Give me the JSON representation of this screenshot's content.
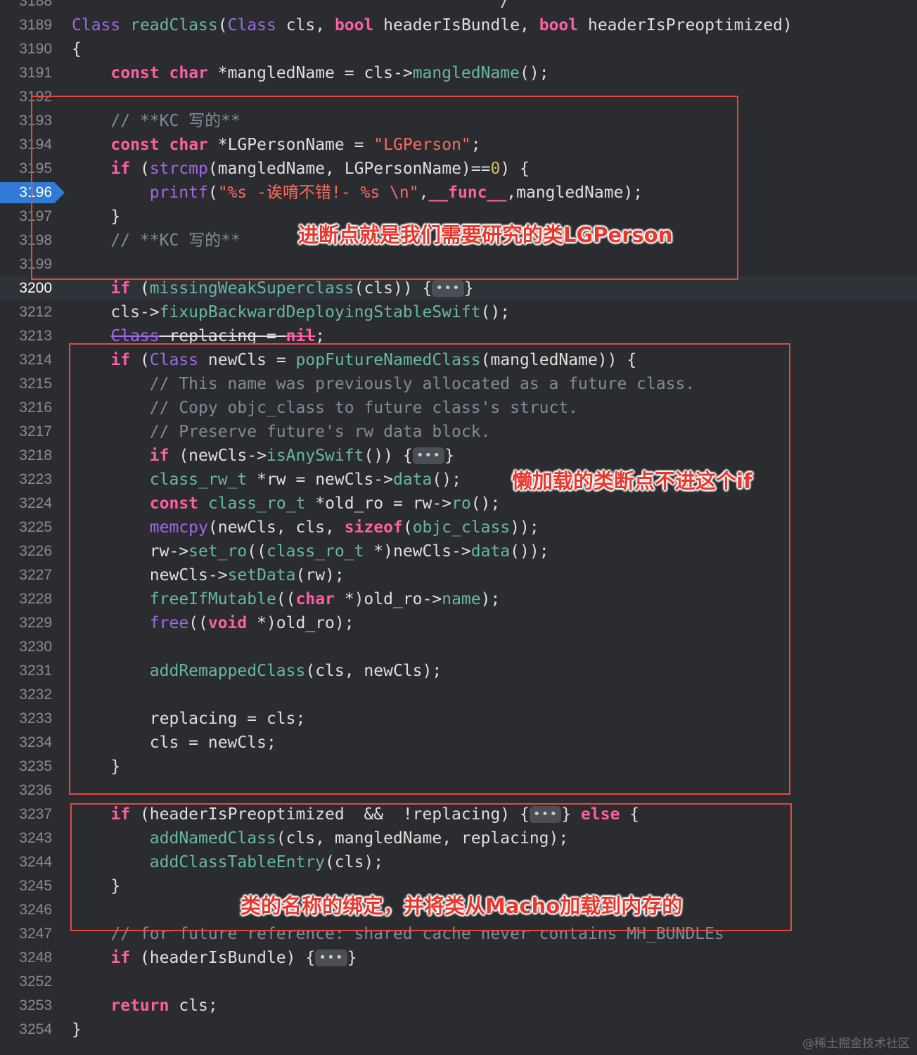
{
  "editor": {
    "lines": [
      {
        "n": "3188",
        "segs": [
          [
            "pl",
            "                                            /"
          ]
        ]
      },
      {
        "n": "3189",
        "segs": [
          [
            "m",
            "Class"
          ],
          [
            "pl",
            " "
          ],
          [
            "f",
            "readClass"
          ],
          [
            "pl",
            "("
          ],
          [
            "m",
            "Class"
          ],
          [
            "pl",
            " cls, "
          ],
          [
            "k",
            "bool"
          ],
          [
            "pl",
            " headerIsBundle, "
          ],
          [
            "k",
            "bool"
          ],
          [
            "pl",
            " headerIsPreoptimized)"
          ]
        ]
      },
      {
        "n": "3190",
        "segs": [
          [
            "pl",
            "{"
          ]
        ]
      },
      {
        "n": "3191",
        "segs": [
          [
            "pl",
            "    "
          ],
          [
            "k",
            "const"
          ],
          [
            "pl",
            " "
          ],
          [
            "k",
            "char"
          ],
          [
            "pl",
            " *mangledName = cls->"
          ],
          [
            "f",
            "mangledName"
          ],
          [
            "pl",
            "();"
          ]
        ]
      },
      {
        "n": "3192",
        "segs": []
      },
      {
        "n": "3193",
        "segs": [
          [
            "pl",
            "    "
          ],
          [
            "c",
            "// **KC 写的**"
          ]
        ]
      },
      {
        "n": "3194",
        "segs": [
          [
            "pl",
            "    "
          ],
          [
            "k",
            "const"
          ],
          [
            "pl",
            " "
          ],
          [
            "k",
            "char"
          ],
          [
            "pl",
            " *LGPersonName = "
          ],
          [
            "s",
            "\"LGPerson\""
          ],
          [
            "pl",
            ";"
          ]
        ]
      },
      {
        "n": "3195",
        "segs": [
          [
            "pl",
            "    "
          ],
          [
            "k",
            "if"
          ],
          [
            "pl",
            " ("
          ],
          [
            "m",
            "strcmp"
          ],
          [
            "pl",
            "(mangledName, LGPersonName)=="
          ],
          [
            "n",
            "0"
          ],
          [
            "pl",
            ") {"
          ]
        ]
      },
      {
        "n": "3196",
        "mark": "breakpoint",
        "segs": [
          [
            "pl",
            "        "
          ],
          [
            "m",
            "printf"
          ],
          [
            "pl",
            "("
          ],
          [
            "s",
            "\"%s -诶唷不错!- %s \\n\""
          ],
          [
            "pl",
            ","
          ],
          [
            "k",
            "__func__"
          ],
          [
            "pl",
            ",mangledName);"
          ]
        ]
      },
      {
        "n": "3197",
        "segs": [
          [
            "pl",
            "    }"
          ]
        ]
      },
      {
        "n": "3198",
        "segs": [
          [
            "pl",
            "    "
          ],
          [
            "c",
            "// **KC 写的**"
          ]
        ]
      },
      {
        "n": "3199",
        "segs": []
      },
      {
        "n": "3200",
        "mark": "current",
        "segs": [
          [
            "pl",
            "    "
          ],
          [
            "k",
            "if"
          ],
          [
            "pl",
            " ("
          ],
          [
            "f",
            "missingWeakSuperclass"
          ],
          [
            "pl",
            "(cls)) {"
          ],
          [
            "fold",
            "•••"
          ],
          [
            "pl",
            "}"
          ]
        ]
      },
      {
        "n": "3212",
        "segs": [
          [
            "pl",
            "    cls->"
          ],
          [
            "f",
            "fixupBackwardDeployingStableSwift"
          ],
          [
            "pl",
            "();"
          ]
        ]
      },
      {
        "n": "3213",
        "segs": [
          [
            "pl",
            "    "
          ],
          [
            "ms",
            "Class"
          ],
          [
            "pls",
            " replacing = "
          ],
          [
            "ks",
            "nil"
          ],
          [
            "pl",
            ";"
          ]
        ]
      },
      {
        "n": "3214",
        "segs": [
          [
            "pl",
            "    "
          ],
          [
            "k",
            "if"
          ],
          [
            "pl",
            " ("
          ],
          [
            "m",
            "Class"
          ],
          [
            "pl",
            " newCls = "
          ],
          [
            "f",
            "popFutureNamedClass"
          ],
          [
            "pl",
            "(mangledName)) {"
          ]
        ]
      },
      {
        "n": "3215",
        "segs": [
          [
            "pl",
            "        "
          ],
          [
            "c",
            "// This name was previously allocated as a future class."
          ]
        ]
      },
      {
        "n": "3216",
        "segs": [
          [
            "pl",
            "        "
          ],
          [
            "c",
            "// Copy objc_class to future class's struct."
          ]
        ]
      },
      {
        "n": "3217",
        "segs": [
          [
            "pl",
            "        "
          ],
          [
            "c",
            "// Preserve future's rw data block."
          ]
        ]
      },
      {
        "n": "3218",
        "segs": [
          [
            "pl",
            "        "
          ],
          [
            "k",
            "if"
          ],
          [
            "pl",
            " (newCls->"
          ],
          [
            "f",
            "isAnySwift"
          ],
          [
            "pl",
            "()) {"
          ],
          [
            "fold",
            "•••"
          ],
          [
            "pl",
            "}"
          ]
        ]
      },
      {
        "n": "3223",
        "segs": [
          [
            "pl",
            "        "
          ],
          [
            "f",
            "class_rw_t"
          ],
          [
            "pl",
            " *rw = newCls->"
          ],
          [
            "f",
            "data"
          ],
          [
            "pl",
            "();"
          ]
        ]
      },
      {
        "n": "3224",
        "segs": [
          [
            "pl",
            "        "
          ],
          [
            "k",
            "const"
          ],
          [
            "pl",
            " "
          ],
          [
            "f",
            "class_ro_t"
          ],
          [
            "pl",
            " *old_ro = rw->"
          ],
          [
            "f",
            "ro"
          ],
          [
            "pl",
            "();"
          ]
        ]
      },
      {
        "n": "3225",
        "segs": [
          [
            "pl",
            "        "
          ],
          [
            "m",
            "memcpy"
          ],
          [
            "pl",
            "(newCls, cls, "
          ],
          [
            "k",
            "sizeof"
          ],
          [
            "pl",
            "("
          ],
          [
            "f",
            "objc_class"
          ],
          [
            "pl",
            "));"
          ]
        ]
      },
      {
        "n": "3226",
        "segs": [
          [
            "pl",
            "        rw->"
          ],
          [
            "f",
            "set_ro"
          ],
          [
            "pl",
            "(("
          ],
          [
            "f",
            "class_ro_t"
          ],
          [
            "pl",
            " *)newCls->"
          ],
          [
            "f",
            "data"
          ],
          [
            "pl",
            "());"
          ]
        ]
      },
      {
        "n": "3227",
        "segs": [
          [
            "pl",
            "        newCls->"
          ],
          [
            "f",
            "setData"
          ],
          [
            "pl",
            "(rw);"
          ]
        ]
      },
      {
        "n": "3228",
        "segs": [
          [
            "pl",
            "        "
          ],
          [
            "f",
            "freeIfMutable"
          ],
          [
            "pl",
            "(("
          ],
          [
            "k",
            "char"
          ],
          [
            "pl",
            " *)old_ro->"
          ],
          [
            "f",
            "name"
          ],
          [
            "pl",
            ");"
          ]
        ]
      },
      {
        "n": "3229",
        "segs": [
          [
            "pl",
            "        "
          ],
          [
            "m",
            "free"
          ],
          [
            "pl",
            "(("
          ],
          [
            "k",
            "void"
          ],
          [
            "pl",
            " *)old_ro);"
          ]
        ]
      },
      {
        "n": "3230",
        "segs": []
      },
      {
        "n": "3231",
        "segs": [
          [
            "pl",
            "        "
          ],
          [
            "f",
            "addRemappedClass"
          ],
          [
            "pl",
            "(cls, newCls);"
          ]
        ]
      },
      {
        "n": "3232",
        "segs": []
      },
      {
        "n": "3233",
        "segs": [
          [
            "pl",
            "        replacing = cls;"
          ]
        ]
      },
      {
        "n": "3234",
        "segs": [
          [
            "pl",
            "        cls = newCls;"
          ]
        ]
      },
      {
        "n": "3235",
        "segs": [
          [
            "pl",
            "    }"
          ]
        ]
      },
      {
        "n": "3236",
        "segs": []
      },
      {
        "n": "3237",
        "segs": [
          [
            "pl",
            "    "
          ],
          [
            "k",
            "if"
          ],
          [
            "pl",
            " (headerIsPreoptimized  &&  !replacing) {"
          ],
          [
            "fold",
            "•••"
          ],
          [
            "pl",
            "} "
          ],
          [
            "k",
            "else"
          ],
          [
            "pl",
            " {"
          ]
        ]
      },
      {
        "n": "3243",
        "segs": [
          [
            "pl",
            "        "
          ],
          [
            "f",
            "addNamedClass"
          ],
          [
            "pl",
            "(cls, mangledName, replacing);"
          ]
        ]
      },
      {
        "n": "3244",
        "segs": [
          [
            "pl",
            "        "
          ],
          [
            "f",
            "addClassTableEntry"
          ],
          [
            "pl",
            "(cls);"
          ]
        ]
      },
      {
        "n": "3245",
        "segs": [
          [
            "pl",
            "    }"
          ]
        ]
      },
      {
        "n": "3246",
        "segs": []
      },
      {
        "n": "3247",
        "segs": [
          [
            "pl",
            "    "
          ],
          [
            "c",
            "// for future reference: shared cache never contains MH_BUNDLEs"
          ]
        ]
      },
      {
        "n": "3248",
        "segs": [
          [
            "pl",
            "    "
          ],
          [
            "k",
            "if"
          ],
          [
            "pl",
            " (headerIsBundle) {"
          ],
          [
            "fold",
            "•••"
          ],
          [
            "pl",
            "}"
          ]
        ]
      },
      {
        "n": "3252",
        "segs": []
      },
      {
        "n": "3253",
        "segs": [
          [
            "pl",
            "    "
          ],
          [
            "k",
            "return"
          ],
          [
            "pl",
            " cls;"
          ]
        ]
      },
      {
        "n": "3254",
        "segs": [
          [
            "pl",
            "}"
          ]
        ]
      }
    ]
  },
  "annotations": {
    "note1": "进断点就是我们需要研究的类LGPerson",
    "note2": "懒加载的类断点不进这个if",
    "note3": "类的名称的绑定，并将类从Macho加载到内存的"
  },
  "watermark": "@稀土掘金技术社区",
  "colors": {
    "background": "#2b2c30",
    "keyword": "#fc5fa3",
    "function": "#67b7a4",
    "type": "#a167e6",
    "comment": "#7f8c98",
    "string": "#fc6a5d",
    "number": "#d0bf69",
    "breakpoint": "#2f7bd5",
    "annotation": "#e8382d"
  }
}
